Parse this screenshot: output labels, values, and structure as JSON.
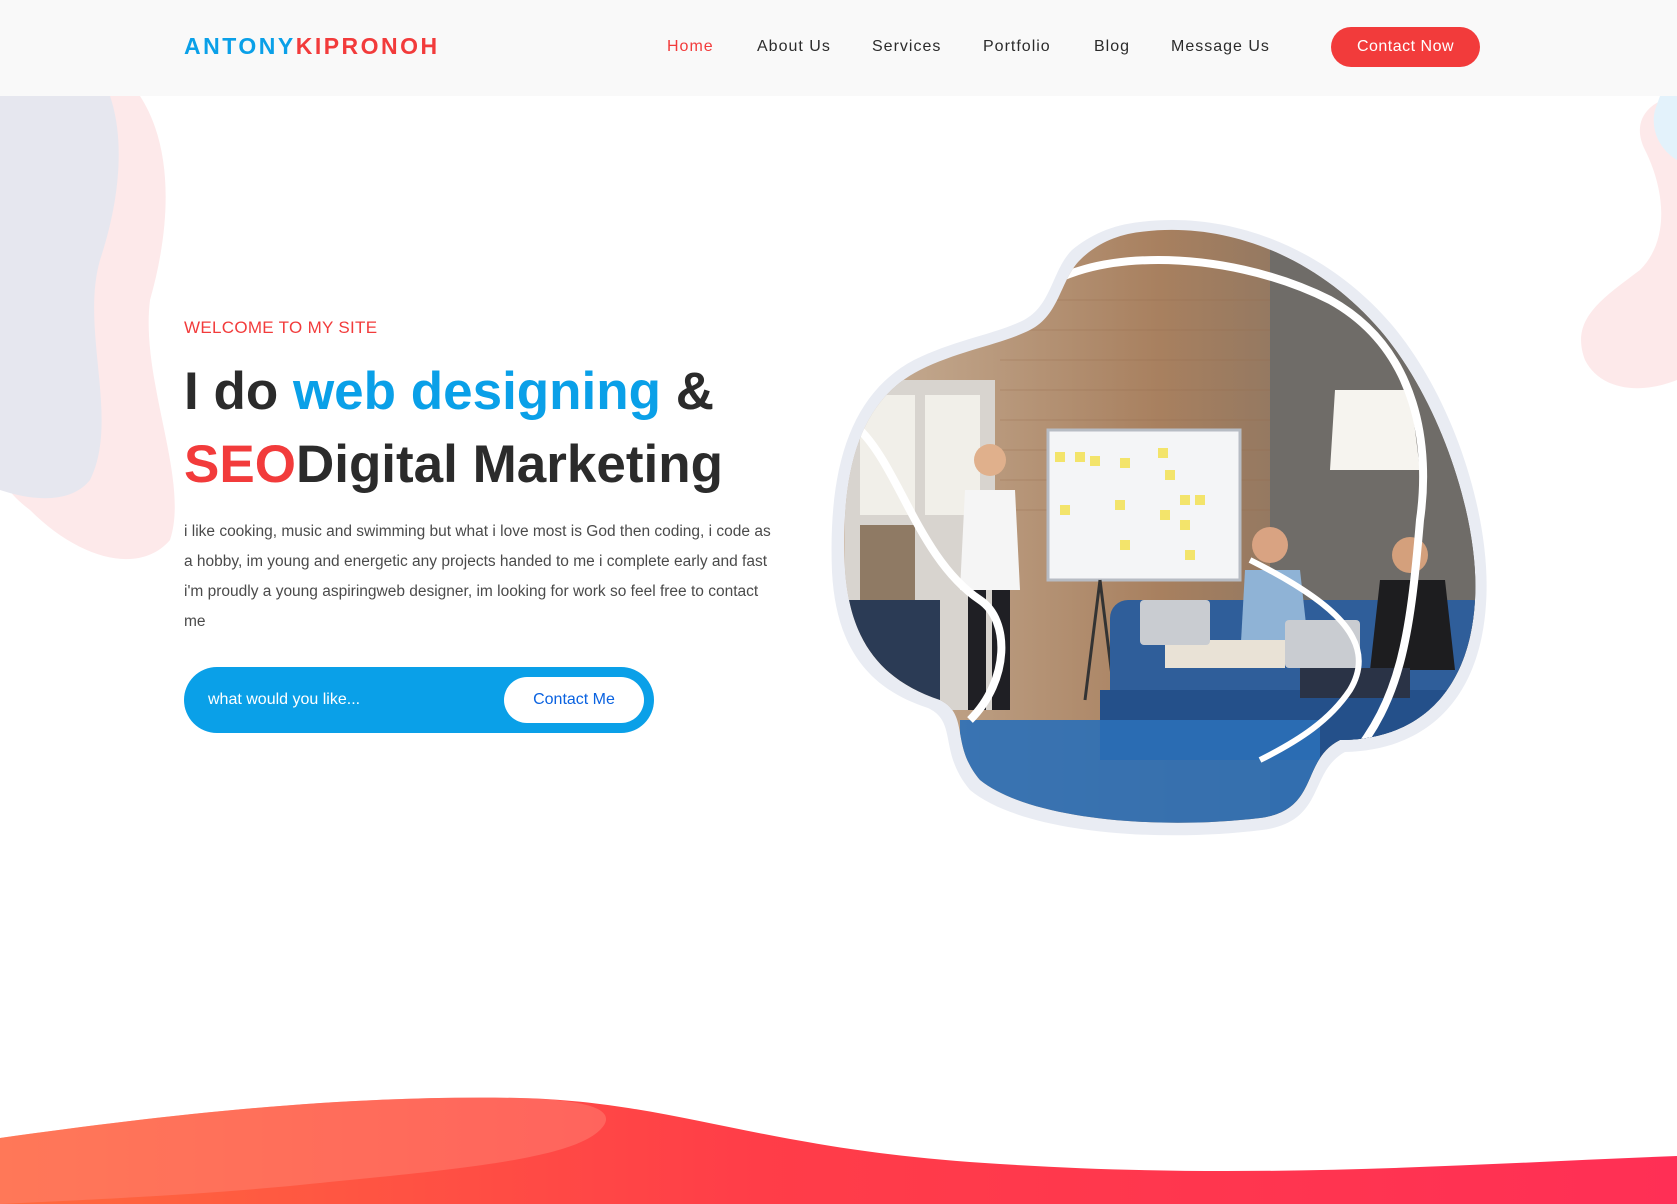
{
  "header": {
    "logo_part1": "ANTONY",
    "logo_part2": "KIPRONOH",
    "nav": [
      {
        "label": "Home",
        "active": true
      },
      {
        "label": "About Us",
        "active": false
      },
      {
        "label": "Services",
        "active": false
      },
      {
        "label": "Portfolio",
        "active": false
      },
      {
        "label": "Blog",
        "active": false
      },
      {
        "label": "Message Us",
        "active": false
      }
    ],
    "cta_label": "Contact Now"
  },
  "hero": {
    "eyebrow": "WELCOME TO MY SITE",
    "headline": {
      "part1": "I do ",
      "highlight1": "web designing",
      "part2": " &",
      "highlight2": "SEO",
      "part3": "Digital Marketing"
    },
    "description": "i like cooking, music and swimming but what i love most is God then coding, i code as a hobby, im young and energetic any projects handed to me i complete early and fast i'm proudly a young aspiringweb designer, im looking for work so feel free to contact me",
    "search_placeholder": "what would you like...",
    "search_button": "Contact Me",
    "image_icon": "team-meeting-photo"
  },
  "colors": {
    "brand_blue": "#0aa0e8",
    "brand_red": "#f23b3b",
    "wave_start": "#ff6a3d",
    "wave_end": "#ff2f55"
  }
}
